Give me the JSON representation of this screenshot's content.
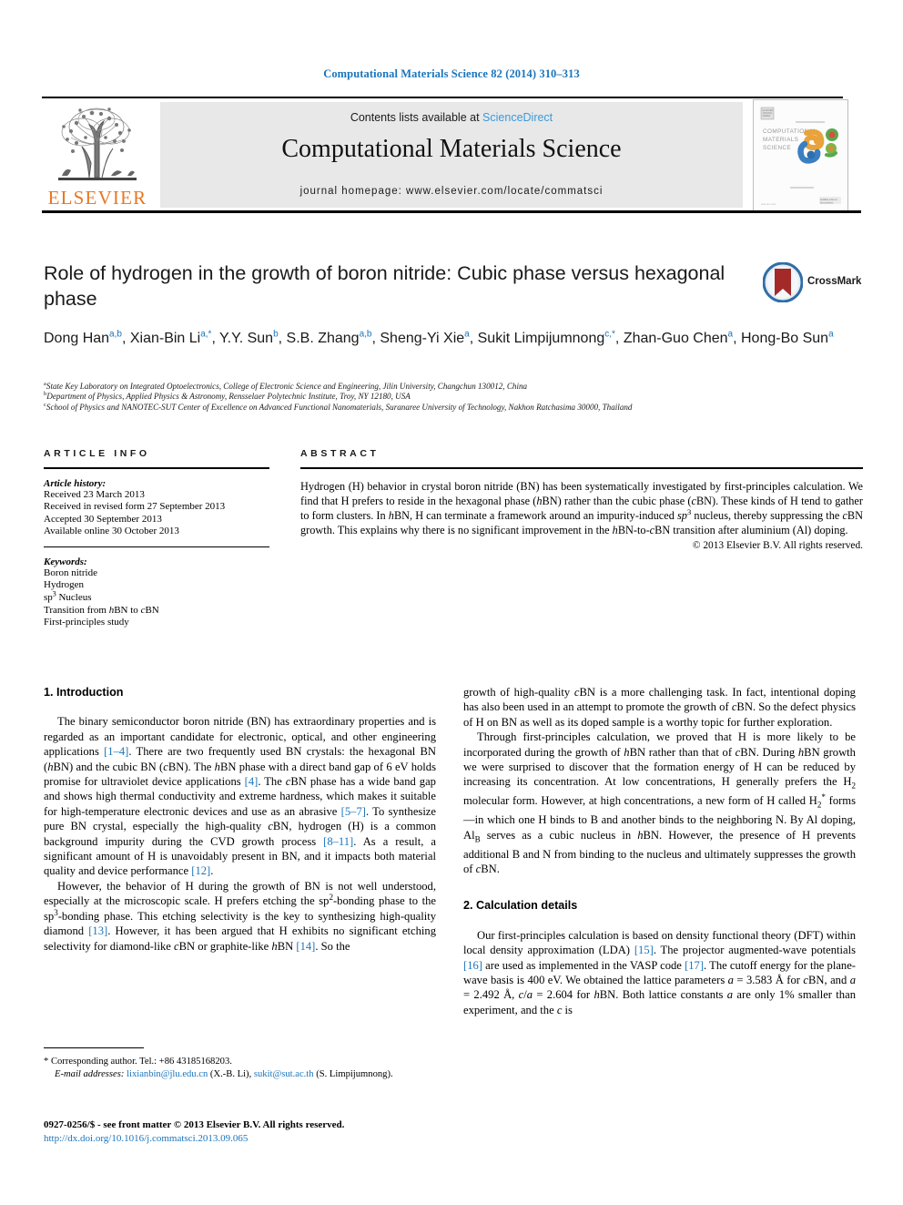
{
  "running_head": "Computational Materials Science 82 (2014) 310–313",
  "masthead": {
    "publisher_logo_name": "elsevier-tree-logo",
    "publisher_wordmark": "ELSEVIER",
    "contents_prefix": "Contents lists available at",
    "contents_link": "ScienceDirect",
    "journal_title": "Computational Materials Science",
    "homepage_line": "journal homepage: www.elsevier.com/locate/commatsci",
    "cover_lines": [
      "COMPUTATIONAL",
      "MATERIALS",
      "SCIENCE"
    ]
  },
  "article": {
    "title": "Role of hydrogen in the growth of boron nitride: Cubic phase versus hexagonal phase",
    "crossmark_label": "CrossMark",
    "authors_html": "Dong Han<sup>a,b</sup>, Xian-Bin Li<sup>a,*</sup>, Y.Y. Sun<sup>b</sup>, S.B. Zhang<sup>a,b</sup>, Sheng-Yi Xie<sup>a</sup>, Sukit Limpijumnong<sup>c,*</sup>, Zhan-Guo Chen<sup>a</sup>, Hong-Bo Sun<sup>a</sup>",
    "affiliations": [
      {
        "marker": "a",
        "text": "State Key Laboratory on Integrated Optoelectronics, College of Electronic Science and Engineering, Jilin University, Changchun 130012, China"
      },
      {
        "marker": "b",
        "text": "Department of Physics, Applied Physics & Astronomy, Rensselaer Polytechnic Institute, Troy, NY 12180, USA"
      },
      {
        "marker": "c",
        "text": "School of Physics and NANOTEC-SUT Center of Excellence on Advanced Functional Nanomaterials, Suranaree University of Technology, Nakhon Ratchasima 30000, Thailand"
      }
    ]
  },
  "article_info": {
    "heading": "ARTICLE INFO",
    "history_label": "Article history:",
    "history": [
      "Received 23 March 2013",
      "Received in revised form 27 September 2013",
      "Accepted 30 September 2013",
      "Available online 30 October 2013"
    ],
    "keywords_label": "Keywords:",
    "keywords_html": [
      "Boron nitride",
      "Hydrogen",
      "sp<sup class=\"num\">3</sup> Nucleus",
      "Transition from <i>h</i>BN to <i>c</i>BN",
      "First-principles study"
    ]
  },
  "abstract": {
    "heading": "ABSTRACT",
    "body_html": "Hydrogen (H) behavior in crystal boron nitride (BN) has been systematically investigated by first-principles calculation. We find that H prefers to reside in the hexagonal phase (<i>h</i>BN) rather than the cubic phase (<i>c</i>BN). These kinds of H tend to gather to form clusters. In <i>h</i>BN, H can terminate a framework around an impurity-induced <i>sp</i><sup class=\"num\">3</sup> nucleus, thereby suppressing the <i>c</i>BN growth. This explains why there is no significant improvement in the <i>h</i>BN-to-<i>c</i>BN transition after aluminium (Al) doping.",
    "copyright": "© 2013 Elsevier B.V. All rights reserved."
  },
  "sections": {
    "introduction_heading": "1. Introduction",
    "calculation_heading": "2. Calculation details",
    "intro_p1_html": "The binary semiconductor boron nitride (BN) has extraordinary properties and is regarded as an important candidate for electronic, optical, and other engineering applications <span class=\"ref\">[1–4]</span>. There are two frequently used BN crystals: the hexagonal BN (<i>h</i>BN) and the cubic BN (<i>c</i>BN). The <i>h</i>BN phase with a direct band gap of 6 eV holds promise for ultraviolet device applications <span class=\"ref\">[4]</span>. The <i>c</i>BN phase has a wide band gap and shows high thermal conductivity and extreme hardness, which makes it suitable for high-temperature electronic devices and use as an abrasive <span class=\"ref\">[5–7]</span>. To synthesize pure BN crystal, especially the high-quality <i>c</i>BN, hydrogen (H) is a common background impurity during the CVD growth process <span class=\"ref\">[8–11]</span>. As a result, a significant amount of H is unavoidably present in BN, and it impacts both material quality and device performance <span class=\"ref\">[12]</span>.",
    "intro_p2_html": "However, the behavior of H during the growth of BN is not well understood, especially at the microscopic scale. H prefers etching the sp<sup class=\"num\">2</sup>-bonding phase to the sp<sup class=\"num\">3</sup>-bonding phase. This etching selectivity is the key to synthesizing high-quality diamond <span class=\"ref\">[13]</span>. However, it has been argued that H exhibits no significant etching selectivity for diamond-like <i>c</i>BN or graphite-like <i>h</i>BN <span class=\"ref\">[14]</span>. So the",
    "intro_p2_cont_html": "growth of high-quality <i>c</i>BN is a more challenging task. In fact, intentional doping has also been used in an attempt to promote the growth of <i>c</i>BN. So the defect physics of H on BN as well as its doped sample is a worthy topic for further exploration.",
    "intro_p3_html": "Through first-principles calculation, we proved that H is more likely to be incorporated during the growth of <i>h</i>BN rather than that of <i>c</i>BN. During <i>h</i>BN growth we were surprised to discover that the formation energy of H can be reduced by increasing its concentration. At low concentrations, H generally prefers the H<sub>2</sub> molecular form. However, at high concentrations, a new form of H called H<sub>2</sub><sup class=\"num\">*</sup> forms—in which one H binds to B and another binds to the neighboring N. By Al doping, Al<sub>B</sub> serves as a cubic nucleus in <i>h</i>BN. However, the presence of H prevents additional B and N from binding to the nucleus and ultimately suppresses the growth of <i>c</i>BN.",
    "calc_p1_html": "Our first-principles calculation is based on density functional theory (DFT) within local density approximation (LDA) <span class=\"ref\">[15]</span>. The projector augmented-wave potentials <span class=\"ref\">[16]</span> are used as implemented in the VASP code <span class=\"ref\">[17]</span>. The cutoff energy for the plane-wave basis is 400 eV. We obtained the lattice parameters <i>a</i> = 3.583 Å for <i>c</i>BN, and <i>a</i> = 2.492 Å, <i>c</i>/<i>a</i> = 2.604 for <i>h</i>BN. Both lattice constants <i>a</i> are only 1% smaller than experiment, and the <i>c</i> is"
  },
  "footnote": {
    "corresponding_html": "* Corresponding author. Tel.: +86 43185168203.",
    "email_html": "<span class=\"ital\">E-mail addresses:</span> <span class=\"lnk\">lixianbin@jlu.edu.cn</span> (X.-B. Li), <span class=\"lnk\">sukit@sut.ac.th</span> (S. Limpijumnong)."
  },
  "page_footer": {
    "issn_line": "0927-0256/$ - see front matter © 2013 Elsevier B.V. All rights reserved.",
    "doi": "http://dx.doi.org/10.1016/j.commatsci.2013.09.065"
  }
}
